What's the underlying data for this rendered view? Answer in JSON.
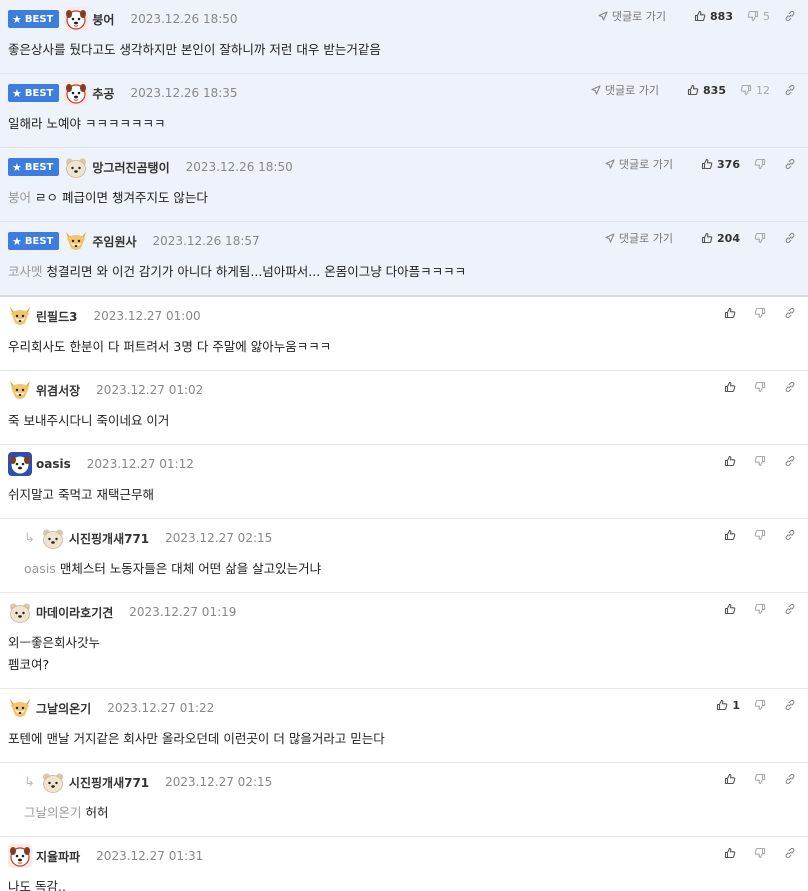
{
  "labels": {
    "best": "BEST",
    "reply_to": "댓글로 가기"
  },
  "comments": [
    {
      "best": true,
      "nick": "붕어",
      "date": "2023.12.26 18:50",
      "up": "883",
      "down": "5",
      "ref": "",
      "text": "좋은상사를 뒀다고도 생각하지만 본인이 잘하니까 저런 대우 받는거같음",
      "reply": false,
      "avatar": "dog-face"
    },
    {
      "best": true,
      "nick": "추공",
      "date": "2023.12.26 18:35",
      "up": "835",
      "down": "12",
      "ref": "",
      "text": "일해라 노예야 ㅋㅋㅋㅋㅋㅋㅋ",
      "reply": false,
      "avatar": "dog-face"
    },
    {
      "best": true,
      "nick": "망그러진곰탱이",
      "date": "2023.12.26 18:50",
      "up": "376",
      "down": "",
      "ref": "붕어",
      "text": "ㄹㅇ 폐급이면 챙겨주지도 않는다",
      "reply": false,
      "avatar": "bear-face"
    },
    {
      "best": true,
      "nick": "주임원사",
      "date": "2023.12.26 18:57",
      "up": "204",
      "down": "",
      "ref": "코사멧",
      "text": "청결리면 와 이건 감기가 아니다 하게됨...넘아파서... 온몸이그냥 다아픔ㅋㅋㅋㅋ",
      "reply": false,
      "avatar": "fox-face"
    },
    {
      "best": false,
      "nick": "린필드3",
      "date": "2023.12.27 01:00",
      "up": "",
      "down": "",
      "ref": "",
      "text": "우리회사도 한분이 다 퍼트려서 3명 다 주말에 앓아누움ㅋㅋㅋ",
      "reply": false,
      "avatar": "fox-face"
    },
    {
      "best": false,
      "nick": "위겸서장",
      "date": "2023.12.27 01:02",
      "up": "",
      "down": "",
      "ref": "",
      "text": "죽 보내주시다니 죽이네요 이거",
      "reply": false,
      "avatar": "fox-face"
    },
    {
      "best": false,
      "nick": "oasis",
      "date": "2023.12.27 01:12",
      "up": "",
      "down": "",
      "ref": "",
      "text": "쉬지말고 죽먹고 재택근무해",
      "reply": false,
      "avatar": "dog-face-blue"
    },
    {
      "best": false,
      "nick": "시진핑개새771",
      "date": "2023.12.27 02:15",
      "up": "",
      "down": "",
      "ref": "oasis",
      "text": "맨체스터 노동자들은 대체 어떤 삶을 살고있는거냐",
      "reply": true,
      "avatar": "bear-face"
    },
    {
      "best": false,
      "nick": "마데이라호기견",
      "date": "2023.12.27 01:19",
      "up": "",
      "down": "",
      "ref": "",
      "text": "외ㅡ좋은회사갓누\n펨코여?",
      "reply": false,
      "avatar": "bear-face"
    },
    {
      "best": false,
      "nick": "그날의온기",
      "date": "2023.12.27 01:22",
      "up": "1",
      "down": "",
      "ref": "",
      "text": "포텐에 맨날 거지같은 회사만 올라오던데 이런곳이 더 많을거라고 믿는다",
      "reply": false,
      "avatar": "fox-face"
    },
    {
      "best": false,
      "nick": "시진핑개새771",
      "date": "2023.12.27 02:15",
      "up": "",
      "down": "",
      "ref": "그날의온기",
      "text": "허허",
      "reply": true,
      "avatar": "bear-face"
    },
    {
      "best": false,
      "nick": "지율파파",
      "date": "2023.12.27 01:31",
      "up": "",
      "down": "",
      "ref": "",
      "text": "나도 독감..",
      "reply": false,
      "avatar": "dog-face"
    }
  ]
}
